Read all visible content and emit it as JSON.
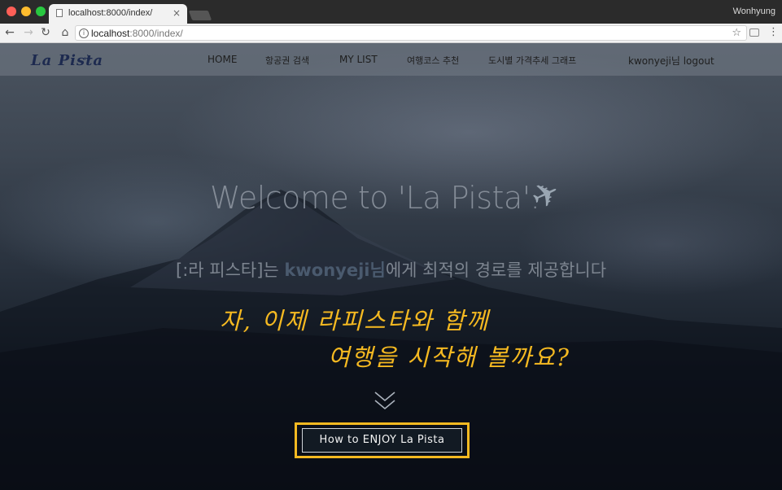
{
  "browser": {
    "tab_title": "localhost:8000/index/",
    "tab_close": "×",
    "profile_name": "Wonhyung",
    "url_host": "localhost",
    "url_path": ":8000/index/"
  },
  "site": {
    "brand": "La Pista",
    "nav": {
      "home": "HOME",
      "flight_search": "항공권 검색",
      "my_list": "MY LIST",
      "course": "여행코스 추천",
      "price_graph": "도시별 가격추세 그래프",
      "user_logout": "kwonyeji님 logout"
    }
  },
  "hero": {
    "title": "Welcome to 'La Pista'.",
    "subtitle_pre": "[:라 피스타]는 ",
    "subtitle_user": "kwonyeji님",
    "subtitle_post": "에게 최적의 경로를 제공합니다",
    "slogan_line1": "자, 이제 라피스타와 함께",
    "slogan_line2": "여행을 시작해 볼까요?",
    "cta": "How to ENJOY La Pista"
  },
  "icons": {
    "brand": "airplane-icon",
    "hero": "airplane-icon",
    "scroll": "double-chevron-down-icon"
  },
  "colors": {
    "accent": "#f5b921",
    "brand": "#1d2a4f"
  }
}
